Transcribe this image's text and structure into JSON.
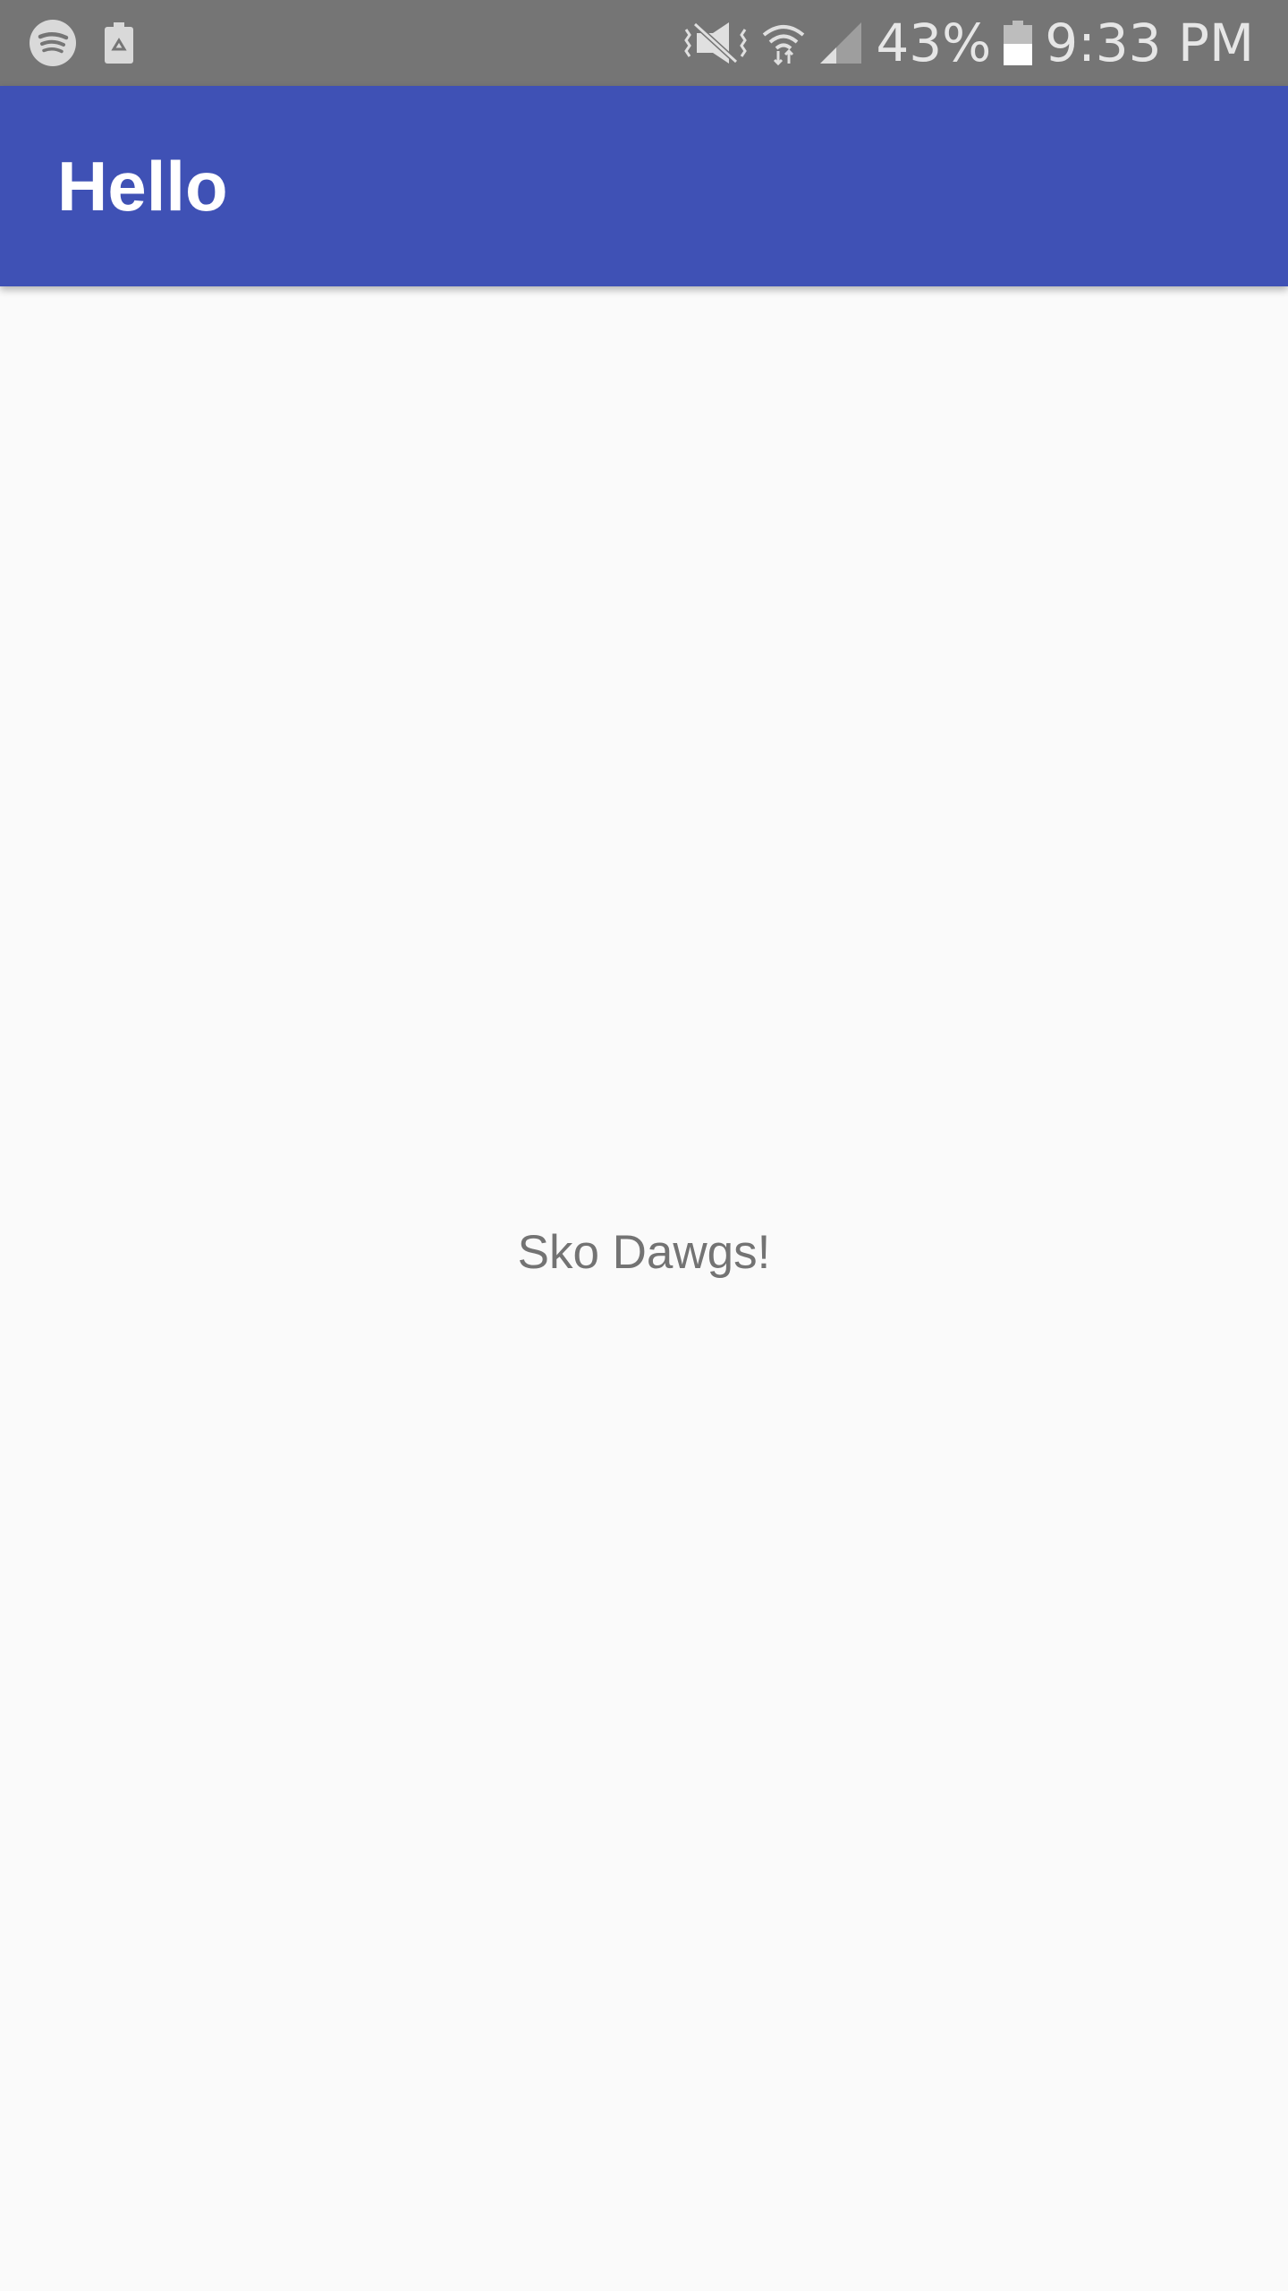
{
  "status_bar": {
    "left_icons": [
      "spotify-icon",
      "battery-saver-icon"
    ],
    "right_icons": [
      "vibrate-mute-icon",
      "wifi-icon",
      "cellular-signal-icon",
      "battery-icon"
    ],
    "battery_percent": "43%",
    "time": "9:33 PM",
    "background_color": "#757575"
  },
  "app_bar": {
    "title": "Hello",
    "background_color": "#3f51b5"
  },
  "main": {
    "message": "Sko Dawgs!"
  }
}
